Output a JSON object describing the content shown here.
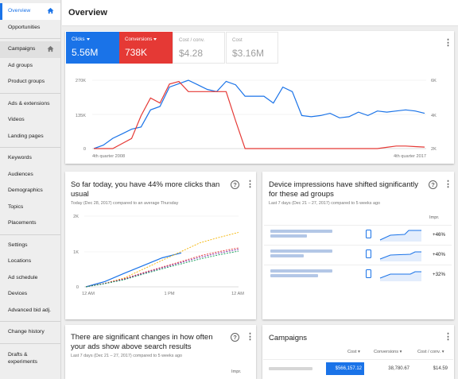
{
  "sidebar": {
    "items": [
      {
        "label": "Overview"
      },
      {
        "label": "Opportunities"
      },
      {
        "label": "Campaigns"
      },
      {
        "label": "Ad groups"
      },
      {
        "label": "Product groups"
      },
      {
        "label": "Ads & extensions"
      },
      {
        "label": "Videos"
      },
      {
        "label": "Landing pages"
      },
      {
        "label": "Keywords"
      },
      {
        "label": "Audiences"
      },
      {
        "label": "Demographics"
      },
      {
        "label": "Topics"
      },
      {
        "label": "Placements"
      },
      {
        "label": "Settings"
      },
      {
        "label": "Locations"
      },
      {
        "label": "Ad schedule"
      },
      {
        "label": "Devices"
      },
      {
        "label": "Advanced bid adj."
      },
      {
        "label": "Change history"
      },
      {
        "label": "Drafts & experiments"
      }
    ]
  },
  "header": {
    "title": "Overview"
  },
  "metrics": {
    "clicks": {
      "label": "Clicks",
      "value": "5.56M"
    },
    "conversions": {
      "label": "Conversions",
      "value": "738K"
    },
    "cost_conv": {
      "label": "Cost / conv.",
      "value": "$4.28"
    },
    "cost": {
      "label": "Cost",
      "value": "$3.16M"
    }
  },
  "colors": {
    "blue": "#1a73e8",
    "red": "#e53935",
    "orange": "#f4b400",
    "green": "#0f9d58"
  },
  "main_chart": {
    "y_left_ticks": [
      "270K",
      "135K",
      "0"
    ],
    "y_right_ticks": [
      "6K",
      "4K",
      "2K"
    ],
    "x_start": "4th quarter 2008",
    "x_end": "4th quarter 2017"
  },
  "today_card": {
    "title": "So far today, you have 44% more clicks than usual",
    "subtitle": "Today (Dec 28, 2017) compared to an average Thursday",
    "y_ticks": [
      "2K",
      "1K",
      "0"
    ],
    "x_ticks": [
      "12 AM",
      "1 PM",
      "12 AM"
    ]
  },
  "device_card": {
    "title": "Device impressions have shifted significantly for these ad groups",
    "subtitle": "Last 7 days (Dec 21 – 27, 2017) compared to 5 weeks ago",
    "col_header": "Impr.",
    "rows": [
      {
        "change": "+46%"
      },
      {
        "change": "+40%"
      },
      {
        "change": "+32%"
      }
    ]
  },
  "search_card": {
    "title": "There are significant changes in how often your ads show above search results",
    "subtitle": "Last 7 days (Dec 21 – 27, 2017) compared to 5 weeks ago",
    "col_header": "Impr."
  },
  "campaigns_card": {
    "title": "Campaigns",
    "columns": [
      "Cost",
      "Conversions",
      "Cost / conv."
    ],
    "rows": [
      {
        "cost": "$566,157.12",
        "conversions": "38,780.67",
        "cost_conv": "$14.59"
      }
    ]
  },
  "chart_data": [
    {
      "type": "line",
      "title": "",
      "x": [
        "4th quarter 2008",
        "",
        "",
        "",
        "",
        "",
        "",
        "",
        "",
        "",
        "",
        "",
        "",
        "",
        "",
        "",
        "",
        "",
        "",
        "",
        "",
        "",
        "",
        "",
        "",
        "",
        "",
        "",
        "",
        "",
        "",
        "",
        "",
        "",
        "",
        "4th quarter 2017"
      ],
      "ylim_left": [
        0,
        270000
      ],
      "ylim_right": [
        0,
        6000
      ],
      "series": [
        {
          "name": "Clicks",
          "color": "#1a73e8",
          "axis": "right",
          "values": [
            0,
            300,
            900,
            1300,
            1700,
            1900,
            3400,
            3700,
            5400,
            5700,
            6000,
            5600,
            5200,
            5000,
            5900,
            5600,
            4600,
            4600,
            4600,
            4000,
            5400,
            5000,
            2900,
            2800,
            2900,
            3100,
            2700,
            2800,
            3200,
            2900,
            3300,
            3200,
            3300,
            3400,
            3300,
            3100
          ]
        },
        {
          "name": "Conversions",
          "color": "#e53935",
          "axis": "left",
          "values": [
            0,
            0,
            0,
            20000,
            40000,
            130000,
            200000,
            180000,
            255000,
            265000,
            225000,
            225000,
            225000,
            225000,
            225000,
            110000,
            0,
            0,
            0,
            0,
            0,
            0,
            0,
            0,
            0,
            0,
            0,
            0,
            0,
            0,
            0,
            5000,
            10000,
            10000,
            8000,
            6000
          ]
        }
      ]
    },
    {
      "type": "line",
      "title": "",
      "x": [
        "12 AM",
        "1 PM",
        "12 AM"
      ],
      "ylim": [
        0,
        2000
      ],
      "series": [
        {
          "color": "#1a73e8",
          "style": "solid",
          "values": [
            0,
            150,
            380,
            600,
            820,
            960
          ]
        },
        {
          "color": "#f4b400",
          "style": "dashed",
          "values": [
            0,
            100,
            250,
            500,
            750,
            1000,
            1250,
            1400,
            1540
          ]
        },
        {
          "color": "#e53935",
          "style": "dashed",
          "values": [
            0,
            100,
            230,
            400,
            560,
            720,
            880,
            1000,
            1100
          ]
        },
        {
          "color": "#7b1fa2",
          "style": "dashed",
          "values": [
            0,
            95,
            215,
            380,
            540,
            690,
            840,
            960,
            1060
          ]
        },
        {
          "color": "#0f9d58",
          "style": "dashed",
          "values": [
            0,
            90,
            200,
            360,
            510,
            650,
            790,
            910,
            1010
          ]
        }
      ]
    }
  ]
}
